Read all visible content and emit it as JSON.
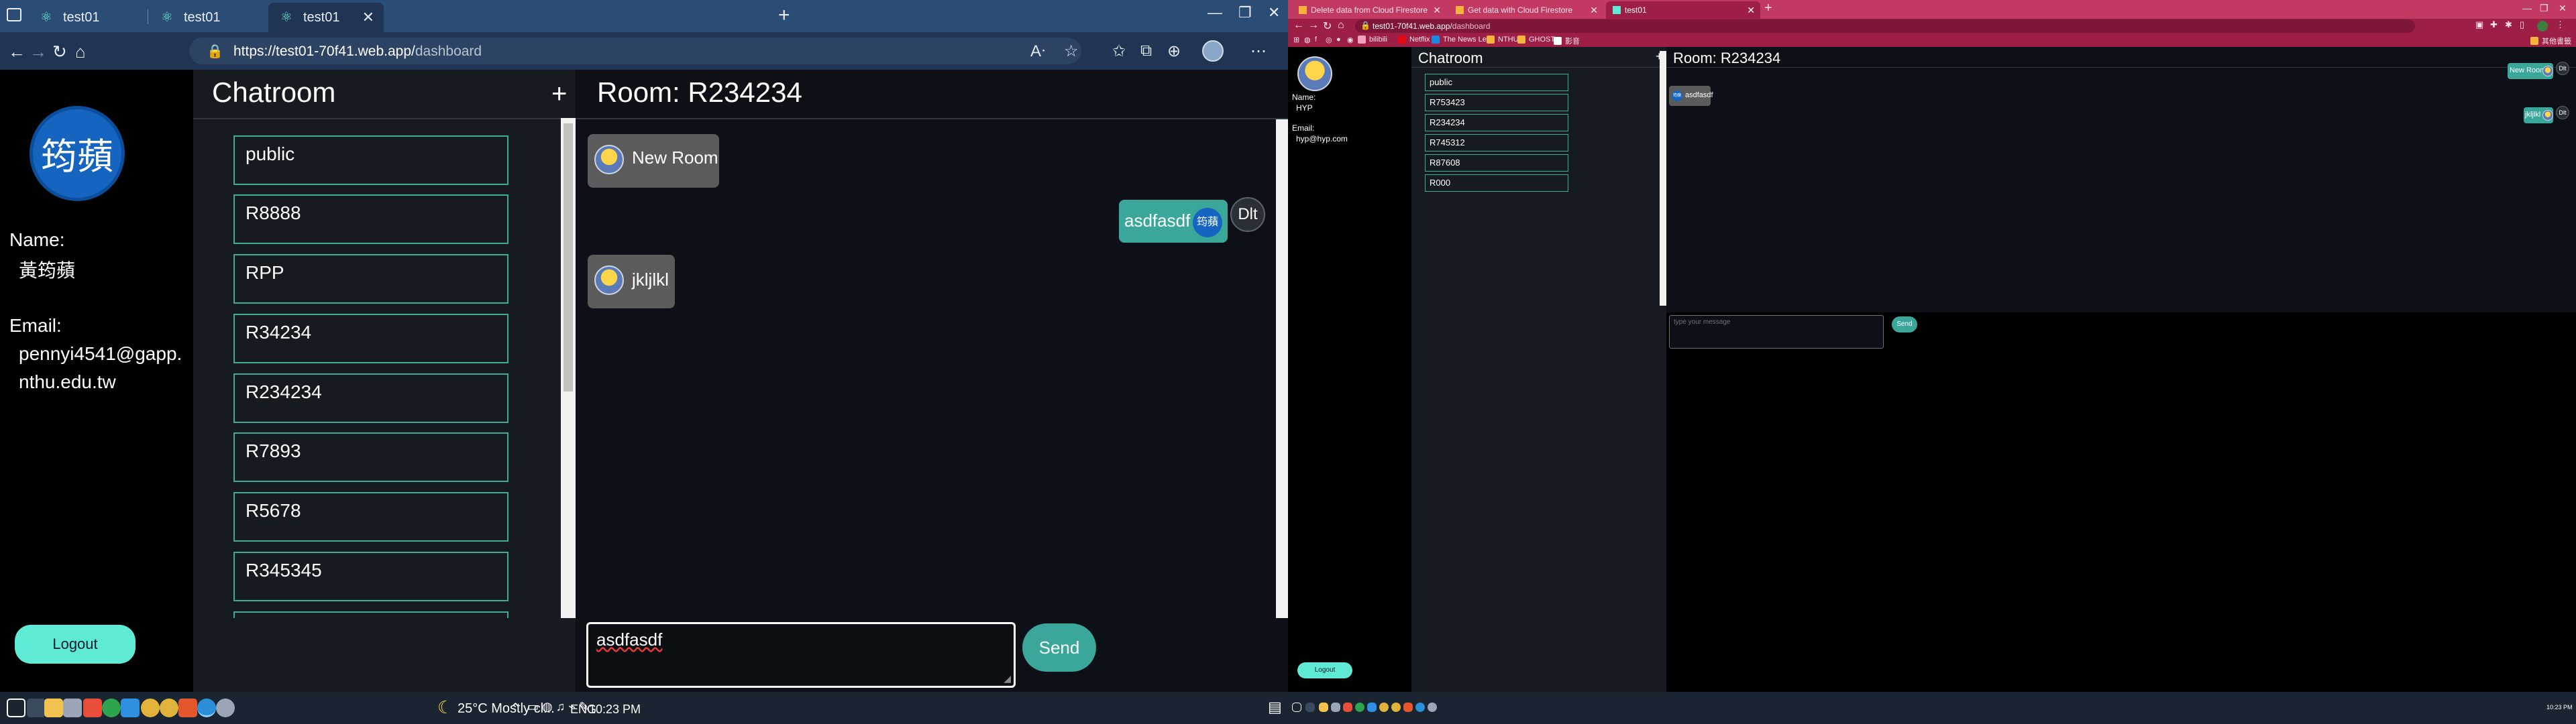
{
  "left": {
    "browser": {
      "tabs": [
        {
          "label": "test01"
        },
        {
          "label": "test01"
        },
        {
          "label": "test01"
        }
      ],
      "url_host": "https://test01-70f41.web.app/",
      "url_path": "dashboard"
    },
    "app": {
      "avatar_text": "筠蘋",
      "name_label": "Name:",
      "name_value": "黃筠蘋",
      "email_label": "Email:",
      "email_line1": "pennyi4541@gapp.",
      "email_line2": "nthu.edu.tw",
      "logout_label": "Logout",
      "rooms_title": "Chatroom",
      "add_label": "+",
      "rooms": [
        {
          "label": "public"
        },
        {
          "label": "R8888"
        },
        {
          "label": "RPP"
        },
        {
          "label": "R34234"
        },
        {
          "label": "R234234"
        },
        {
          "label": "R7893"
        },
        {
          "label": "R5678"
        },
        {
          "label": "R345345"
        }
      ],
      "room_title": "Room: R234234",
      "messages": [
        {
          "text": "New Room",
          "side": "left"
        },
        {
          "text": "asdfasdf",
          "side": "right",
          "avatar_text": "筠蘋",
          "delete_label": "Dlt"
        },
        {
          "text": "jkljlkl",
          "side": "left"
        }
      ],
      "composer_value": "asdfasdf",
      "send_label": "Send"
    },
    "taskbar": {
      "weather": "25°C  Mostly cl...",
      "lang": "ENG",
      "time": "10:23 PM"
    }
  },
  "right": {
    "browser": {
      "tabs": [
        {
          "label": "Delete data from Cloud Firestore"
        },
        {
          "label": "Get data with Cloud Firestore"
        },
        {
          "label": "test01"
        }
      ],
      "url_host": "test01-70f41.web.app/",
      "url_path": "dashboard",
      "bookmarks": [
        {
          "label": "bilibili"
        },
        {
          "label": "Netflix"
        },
        {
          "label": "The News Lens"
        },
        {
          "label": "NTHU"
        },
        {
          "label": "GHOST"
        },
        {
          "label": "影音"
        },
        {
          "label": "其他書籤"
        }
      ]
    },
    "app": {
      "name_label": "Name:",
      "name_value": "HYP",
      "email_label": "Email:",
      "email_value": "hyp@hyp.com",
      "logout_label": "Logout",
      "rooms_title": "Chatroom",
      "add_label": "+",
      "rooms": [
        {
          "label": "public"
        },
        {
          "label": "R753423"
        },
        {
          "label": "R234234"
        },
        {
          "label": "R745312"
        },
        {
          "label": "R87608"
        },
        {
          "label": "R000"
        }
      ],
      "room_title": "Room: R234234",
      "messages": [
        {
          "text": "New Room",
          "side": "right",
          "delete_label": "Dlt"
        },
        {
          "text": "asdfasdf",
          "side": "left",
          "avatar_text": "筠蘋"
        },
        {
          "text": "jkljlkl",
          "side": "right",
          "delete_label": "Dlt"
        }
      ],
      "composer_placeholder": "type your message",
      "send_label": "Send"
    },
    "taskbar": {
      "time": "10:23 PM"
    }
  },
  "colors": {
    "accent_teal": "#3fa99a",
    "logout_bg": "#5eead4",
    "edge_chrome": "#1f3553",
    "chrome_theme": "#9e1f45"
  }
}
